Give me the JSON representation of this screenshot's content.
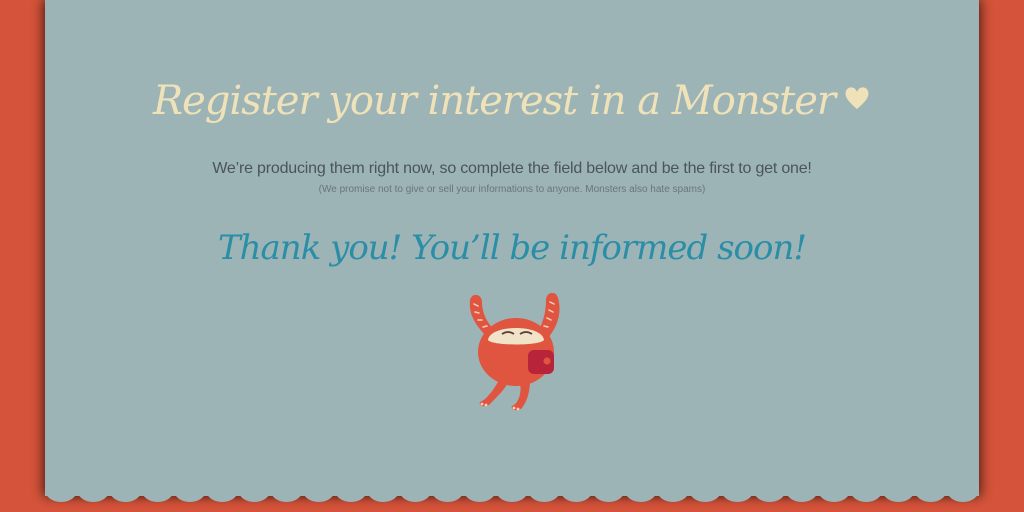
{
  "headline": "Register your interest in a Monster",
  "subheadline": "We’re producing them right now, so complete the field below and be the first to get one!",
  "privacy_note": "(We promise not to give or sell your informations to anyone. Monsters also hate spams)",
  "confirmation": "Thank you! You’ll be informed soon!",
  "icons": {
    "heart": "heart-icon",
    "mascot": "monster-mascot"
  },
  "colors": {
    "background": "#d4533a",
    "panel": "#9db4b7",
    "headline": "#f0e2b8",
    "confirmation": "#2a8ea6",
    "monster": "#e0553f"
  }
}
